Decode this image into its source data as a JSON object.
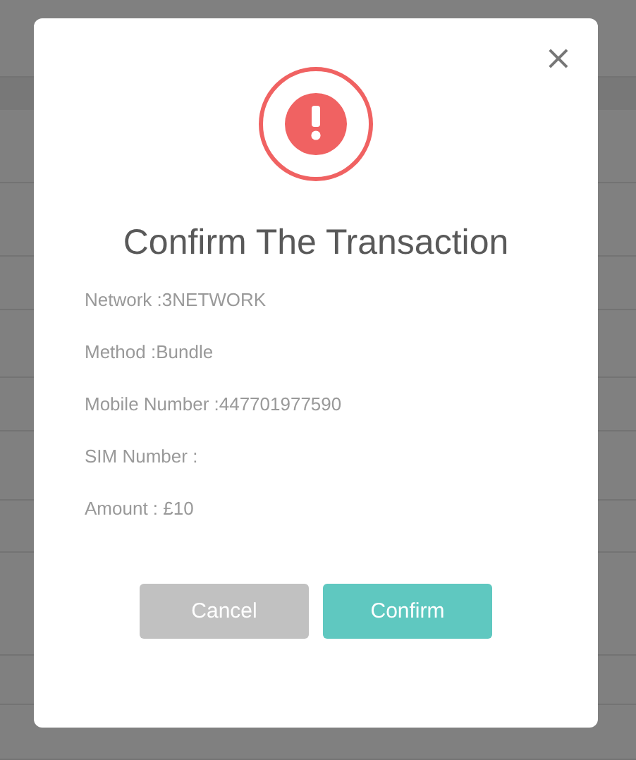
{
  "dialog": {
    "close": "×",
    "title": "Confirm The Transaction",
    "details": [
      "Network :3NETWORK",
      "Method :Bundle",
      "Mobile Number :447701977590",
      "SIM Number :",
      "Amount : £10"
    ],
    "buttons": [
      {
        "label": "Cancel",
        "kind": "cancel"
      },
      {
        "label": "Confirm",
        "kind": "confirm"
      }
    ]
  }
}
